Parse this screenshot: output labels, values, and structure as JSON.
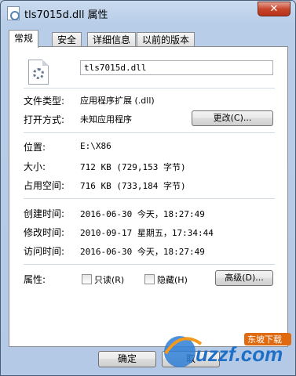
{
  "window": {
    "title": "tls7015d.dll 属性",
    "close_label": "✕"
  },
  "tabs": [
    {
      "label": "常规"
    },
    {
      "label": "安全"
    },
    {
      "label": "详细信息"
    },
    {
      "label": "以前的版本"
    }
  ],
  "general": {
    "filename": "tls7015d.dll",
    "file_type_label": "文件类型:",
    "file_type_value": "应用程序扩展 (.dll)",
    "open_with_label": "打开方式:",
    "open_with_value": "未知应用程序",
    "change_button": "更改(C)...",
    "location_label": "位置:",
    "location_value": "E:\\X86",
    "size_label": "大小:",
    "size_value": "712 KB (729,153 字节)",
    "size_on_disk_label": "占用空间:",
    "size_on_disk_value": "716 KB (733,184 字节)",
    "created_label": "创建时间:",
    "created_value": "2016-06-30 今天，18:27:49",
    "modified_label": "修改时间:",
    "modified_value": "2010-09-17 星期五，17:34:44",
    "accessed_label": "访问时间:",
    "accessed_value": "2016-06-30 今天，18:27:49",
    "attributes_label": "属性:",
    "readonly_label": "只读(R)",
    "hidden_label": "隐藏(H)",
    "advanced_button": "高级(D)..."
  },
  "footer": {
    "ok_button": "确定",
    "cancel_fragment": "取"
  },
  "watermark": {
    "text": "uzzf.com",
    "badge": "东坡下载"
  }
}
